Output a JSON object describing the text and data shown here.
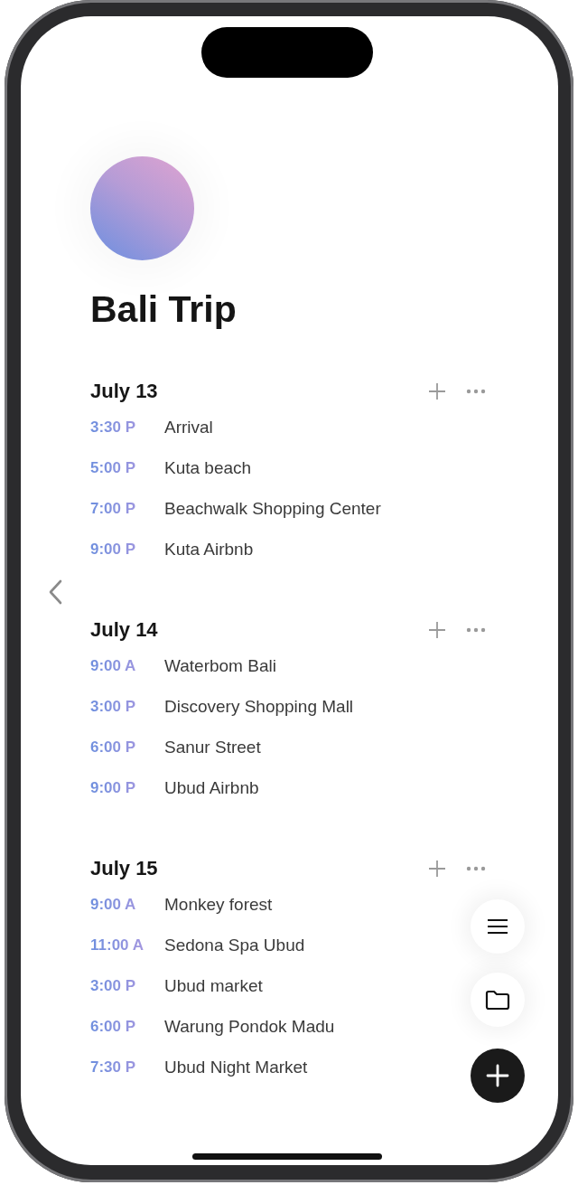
{
  "title": "Bali Trip",
  "days": [
    {
      "date": "July 13",
      "items": [
        {
          "time": "3:30 P",
          "title": "Arrival"
        },
        {
          "time": "5:00 P",
          "title": "Kuta beach"
        },
        {
          "time": "7:00 P",
          "title": "Beachwalk Shopping Center"
        },
        {
          "time": "9:00 P",
          "title": "Kuta Airbnb"
        }
      ]
    },
    {
      "date": "July 14",
      "items": [
        {
          "time": "9:00 A",
          "title": "Waterbom Bali"
        },
        {
          "time": "3:00 P",
          "title": "Discovery Shopping Mall"
        },
        {
          "time": "6:00 P",
          "title": "Sanur Street"
        },
        {
          "time": "9:00 P",
          "title": "Ubud Airbnb"
        }
      ]
    },
    {
      "date": "July 15",
      "items": [
        {
          "time": "9:00 A",
          "title": "Monkey forest"
        },
        {
          "time": "11:00 A",
          "title": "Sedona Spa Ubud"
        },
        {
          "time": "3:00 P",
          "title": "Ubud market"
        },
        {
          "time": "6:00 P",
          "title": "Warung Pondok Madu"
        },
        {
          "time": "7:30 P",
          "title": "Ubud Night Market"
        }
      ]
    }
  ]
}
